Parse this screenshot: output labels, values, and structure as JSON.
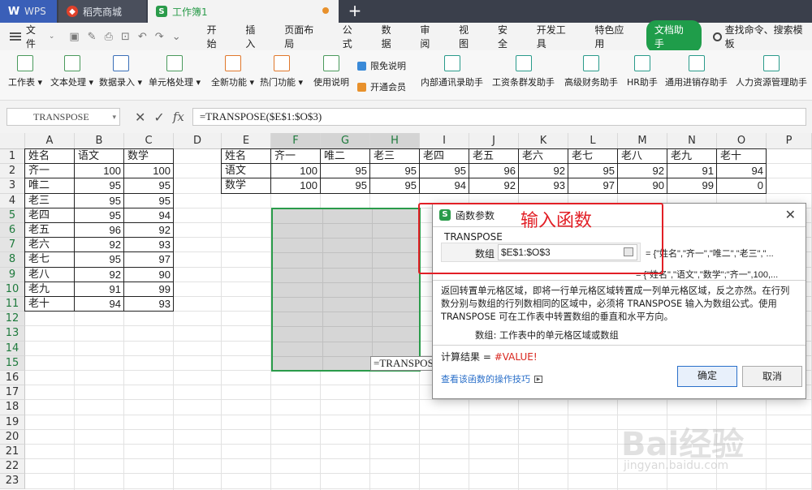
{
  "tabs": {
    "wps": "WPS",
    "store": "稻壳商城",
    "book": "工作簿1"
  },
  "menubar": {
    "file": "文件",
    "items": [
      "开始",
      "插入",
      "页面布局",
      "公式",
      "数据",
      "审阅",
      "视图",
      "安全",
      "开发工具",
      "特色应用"
    ],
    "doc_helper": "文档助手",
    "search": "查找命令、搜索模板"
  },
  "ribbon": {
    "buttons": [
      "工作表",
      "文本处理",
      "数据录入",
      "单元格处理",
      "全新功能",
      "热门功能",
      "使用说明"
    ],
    "small": [
      "限免说明",
      "开通会员"
    ],
    "helpers": [
      "内部通讯录助手",
      "工资条群发助手",
      "高级财务助手",
      "HR助手",
      "通用进销存助手",
      "人力资源管理助手"
    ]
  },
  "formula_bar": {
    "name_box": "TRANSPOSE",
    "formula": "=TRANSPOSE($E$1:$O$3)"
  },
  "grid": {
    "columns": [
      "A",
      "B",
      "C",
      "D",
      "E",
      "F",
      "G",
      "H",
      "I",
      "J",
      "K",
      "L",
      "M",
      "N",
      "O",
      "P"
    ],
    "rows": [
      "1",
      "2",
      "3",
      "4",
      "5",
      "6",
      "7",
      "8",
      "9",
      "10",
      "11",
      "12",
      "13",
      "14",
      "15",
      "16",
      "17",
      "18",
      "19",
      "20",
      "21",
      "22",
      "23"
    ],
    "left_table": {
      "headers": [
        "姓名",
        "语文",
        "数学"
      ],
      "rows": [
        [
          "齐一",
          "100",
          "100"
        ],
        [
          "唯二",
          "95",
          "95"
        ],
        [
          "老三",
          "95",
          "95"
        ],
        [
          "老四",
          "95",
          "94"
        ],
        [
          "老五",
          "96",
          "92"
        ],
        [
          "老六",
          "92",
          "93"
        ],
        [
          "老七",
          "95",
          "97"
        ],
        [
          "老八",
          "92",
          "90"
        ],
        [
          "老九",
          "91",
          "99"
        ],
        [
          "老十",
          "94",
          "93"
        ]
      ]
    },
    "right_table": {
      "row1": [
        "姓名",
        "齐一",
        "唯二",
        "老三",
        "老四",
        "老五",
        "老六",
        "老七",
        "老八",
        "老九",
        "老十"
      ],
      "row2": [
        "语文",
        "100",
        "95",
        "95",
        "95",
        "96",
        "92",
        "95",
        "92",
        "91",
        "94"
      ],
      "row3": [
        "数学",
        "100",
        "95",
        "95",
        "94",
        "92",
        "93",
        "97",
        "90",
        "99",
        "0"
      ]
    },
    "inline_formula": "=TRANSPOSE($"
  },
  "dialog": {
    "title": "函数参数",
    "function_name": "TRANSPOSE",
    "arg_label": "数组",
    "arg_value": "$E$1:$O$3",
    "arg_preview": "= {\"姓名\",\"齐一\",\"唯二\",\"老三\",\"...",
    "result_preview": "= {\"姓名\",\"语文\",\"数学\";\"齐一\",100,...",
    "description": "返回转置单元格区域，即将一行单元格区域转置成一列单元格区域，反之亦然。在行列数分别与数组的行列数相同的区域中，必须将 TRANSPOSE 输入为数组公式。使用 TRANSPOSE 可在工作表中转置数组的垂直和水平方向。",
    "arg_description": "数组:   工作表中的单元格区域或数组",
    "calc_label": "计算结果 = ",
    "calc_value": "#VALUE!",
    "help_link": "查看该函数的操作技巧",
    "ok": "确定",
    "cancel": "取消"
  },
  "annotation": "输入函数",
  "watermark": "Bai经验",
  "watermark_url": "jingyan.baidu.com"
}
